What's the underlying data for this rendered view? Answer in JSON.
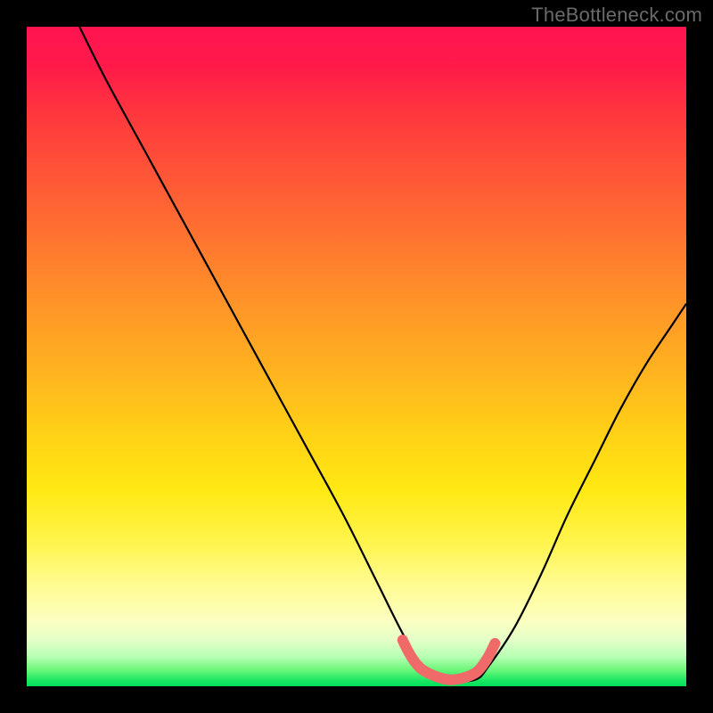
{
  "watermark": "TheBottleneck.com",
  "chart_data": {
    "type": "line",
    "title": "",
    "xlabel": "",
    "ylabel": "",
    "xlim": [
      0,
      100
    ],
    "ylim": [
      0,
      100
    ],
    "grid": false,
    "legend": false,
    "series": [
      {
        "name": "bottleneck-curve",
        "color": "#000000",
        "x": [
          8,
          12,
          18,
          24,
          30,
          36,
          42,
          48,
          53,
          57,
          60,
          64,
          68,
          70,
          74,
          78,
          82,
          86,
          90,
          94,
          98,
          100
        ],
        "values": [
          100,
          92,
          81,
          70,
          59,
          48,
          37,
          26,
          16,
          8,
          3,
          1,
          1,
          3,
          9,
          17,
          26,
          34,
          42,
          49,
          55,
          58
        ]
      },
      {
        "name": "sweet-spot-band",
        "color": "#f06a6a",
        "x": [
          57,
          58,
          59,
          60,
          62,
          64,
          66,
          68,
          69,
          70,
          71
        ],
        "values": [
          7,
          5,
          3.5,
          2.5,
          1.5,
          1,
          1.2,
          2,
          3,
          4.5,
          6.5
        ]
      }
    ],
    "background_gradient_stops": [
      {
        "pos": 0.0,
        "color": "#ff1450"
      },
      {
        "pos": 0.24,
        "color": "#ff5a36"
      },
      {
        "pos": 0.54,
        "color": "#ffb81e"
      },
      {
        "pos": 0.78,
        "color": "#fff44a"
      },
      {
        "pos": 0.93,
        "color": "#e4ffc8"
      },
      {
        "pos": 1.0,
        "color": "#00e05a"
      }
    ]
  }
}
